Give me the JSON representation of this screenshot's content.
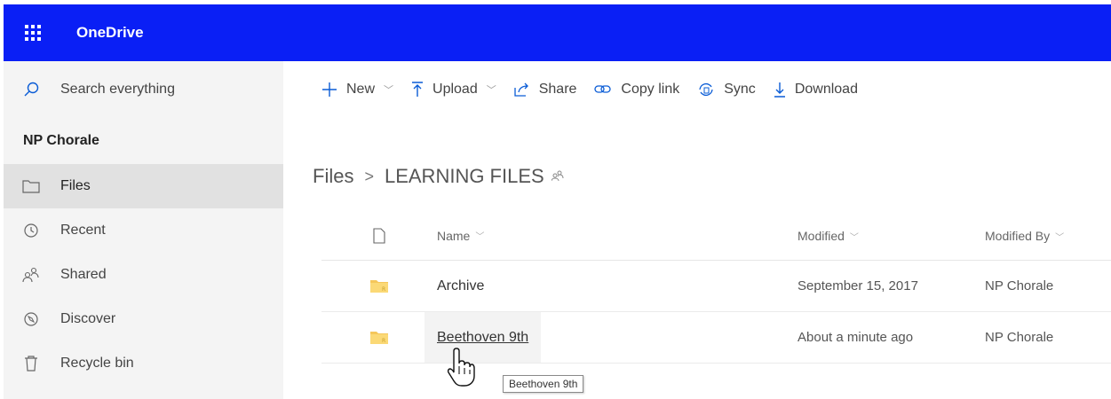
{
  "app": {
    "name": "OneDrive",
    "bar_color": "#0a1ff5"
  },
  "nav": {
    "search_label": "Search everything",
    "site_title": "NP Chorale",
    "items": [
      {
        "label": "Files",
        "icon": "folder-icon",
        "selected": true
      },
      {
        "label": "Recent",
        "icon": "clock-icon",
        "selected": false
      },
      {
        "label": "Shared",
        "icon": "people-icon",
        "selected": false
      },
      {
        "label": "Discover",
        "icon": "compass-icon",
        "selected": false
      },
      {
        "label": "Recycle bin",
        "icon": "trash-icon",
        "selected": false
      }
    ]
  },
  "commands": {
    "new": "New",
    "upload": "Upload",
    "share": "Share",
    "copy_link": "Copy link",
    "sync": "Sync",
    "download": "Download"
  },
  "breadcrumb": {
    "root": "Files",
    "current": "LEARNING FILES"
  },
  "columns": {
    "name": "Name",
    "modified": "Modified",
    "modified_by": "Modified By"
  },
  "rows": [
    {
      "name": "Archive",
      "modified": "September 15, 2017",
      "modified_by": "NP Chorale"
    },
    {
      "name": "Beethoven 9th",
      "modified": "About a minute ago",
      "modified_by": "NP Chorale"
    }
  ],
  "tooltip": "Beethoven 9th"
}
